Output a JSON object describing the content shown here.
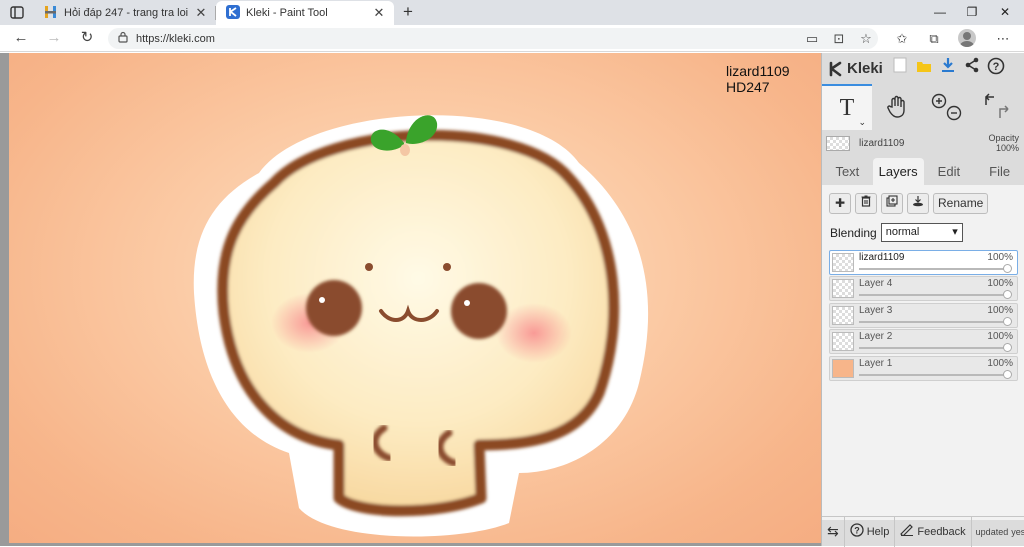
{
  "browser": {
    "tabs": [
      {
        "title": "Hỏi đáp 247 - trang tra loi",
        "active": false
      },
      {
        "title": "Kleki - Paint Tool",
        "active": true
      }
    ],
    "url": "https://kleki.com"
  },
  "canvas": {
    "watermark_lines": [
      "lizard1109",
      "HD247"
    ]
  },
  "panel": {
    "logo": "Kleki",
    "current_layer": {
      "name": "lizard1109",
      "opacity_label": "Opacity",
      "opacity_value": "100%"
    },
    "tabs": [
      "Text",
      "Layers",
      "Edit",
      "File"
    ],
    "active_tab": "Layers",
    "rename_label": "Rename",
    "blending_label": "Blending",
    "blending_value": "normal",
    "layers": [
      {
        "name": "lizard1109",
        "opacity": "100%",
        "selected": true
      },
      {
        "name": "Layer 4",
        "opacity": "100%",
        "selected": false
      },
      {
        "name": "Layer 3",
        "opacity": "100%",
        "selected": false
      },
      {
        "name": "Layer 2",
        "opacity": "100%",
        "selected": false
      },
      {
        "name": "Layer 1",
        "opacity": "100%",
        "selected": false
      }
    ],
    "bottom": {
      "help": "Help",
      "feedback": "Feedback",
      "updated_line1": "updated",
      "updated_line2": "yesterday"
    }
  },
  "colors": {
    "accent": "#3a8de0",
    "panel_bg": "#dcdcdc",
    "canvas_bg": "#f7b58a",
    "outline": "#8b4a24",
    "sprout": "#3aa32b"
  }
}
